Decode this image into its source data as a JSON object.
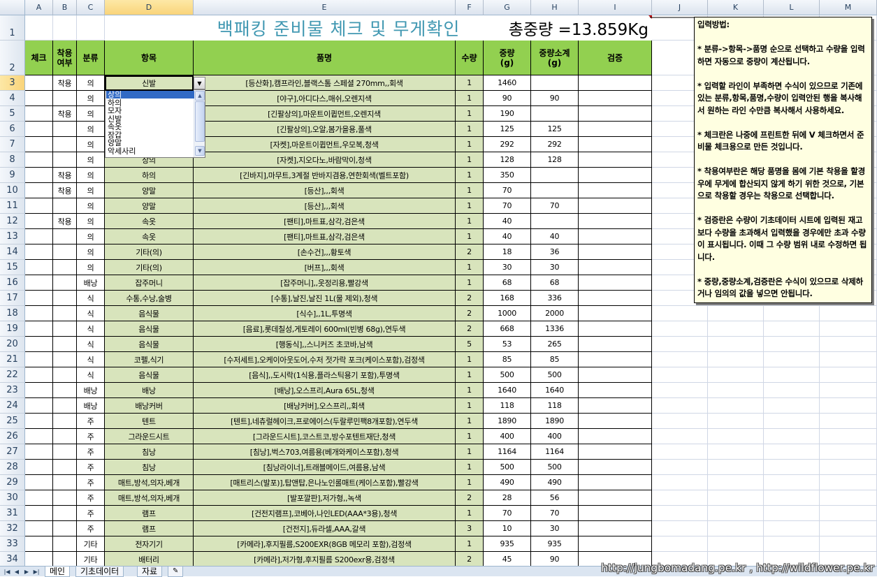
{
  "columns": [
    "A",
    "B",
    "C",
    "D",
    "E",
    "F",
    "G",
    "H",
    "I",
    "J",
    "K",
    "L",
    "M"
  ],
  "selected_column": "D",
  "selected_row": "3",
  "sheet_title": "백패킹 준비물 체크 및 무게확인",
  "total_weight": "총중량 =13.859Kg",
  "headers": {
    "check": "체크",
    "worn": "착용\n여부",
    "category": "분류",
    "item": "항목",
    "product": "품명",
    "qty": "수량",
    "weight": "중량\n(g)",
    "subtotal": "중량소계\n(g)",
    "verify": "검증"
  },
  "rows": [
    {
      "n": "3",
      "worn": "착용",
      "cat": "의",
      "item": "신발",
      "product": "[등산화],캠프라인,블랙스톰 스페셜 270mm,,회색",
      "qty": "1",
      "w": "1460",
      "sub": ""
    },
    {
      "n": "4",
      "worn": "",
      "cat": "의",
      "item": "",
      "product": "[야구],아디다스,매쉬,오렌지색",
      "qty": "1",
      "w": "90",
      "sub": "90"
    },
    {
      "n": "5",
      "worn": "착용",
      "cat": "의",
      "item": "",
      "product": "[긴팔상의],마운트이큅먼트,오렌지색",
      "qty": "1",
      "w": "190",
      "sub": ""
    },
    {
      "n": "6",
      "worn": "",
      "cat": "의",
      "item": "",
      "product": "[긴팔상의],오알,봄가을용,풀색",
      "qty": "1",
      "w": "125",
      "sub": "125"
    },
    {
      "n": "7",
      "worn": "",
      "cat": "의",
      "item": "",
      "product": "[자켓],마운트이큅먼트,우모복,청색",
      "qty": "1",
      "w": "292",
      "sub": "292"
    },
    {
      "n": "8",
      "worn": "",
      "cat": "의",
      "item": "상의",
      "product": "[자켓],지오다노,바람막이,청색",
      "qty": "1",
      "w": "128",
      "sub": "128"
    },
    {
      "n": "9",
      "worn": "착용",
      "cat": "의",
      "item": "하의",
      "product": "[긴바지],마무트,3계절 반바지겸용,연한회색(벨트포함)",
      "qty": "1",
      "w": "350",
      "sub": ""
    },
    {
      "n": "10",
      "worn": "착용",
      "cat": "의",
      "item": "양말",
      "product": "[등산],,,회색",
      "qty": "1",
      "w": "70",
      "sub": ""
    },
    {
      "n": "11",
      "worn": "",
      "cat": "의",
      "item": "양말",
      "product": "[등산],,,회색",
      "qty": "1",
      "w": "70",
      "sub": "70"
    },
    {
      "n": "12",
      "worn": "착용",
      "cat": "의",
      "item": "속옷",
      "product": "[팬티],마트표,삼각,검은색",
      "qty": "1",
      "w": "40",
      "sub": ""
    },
    {
      "n": "13",
      "worn": "",
      "cat": "의",
      "item": "속옷",
      "product": "[팬티],마트표,삼각,검은색",
      "qty": "1",
      "w": "40",
      "sub": "40"
    },
    {
      "n": "14",
      "worn": "",
      "cat": "의",
      "item": "기타(의)",
      "product": "[손수건],,,황토색",
      "qty": "2",
      "w": "18",
      "sub": "36"
    },
    {
      "n": "15",
      "worn": "",
      "cat": "의",
      "item": "기타(의)",
      "product": "[버프],,,회색",
      "qty": "1",
      "w": "30",
      "sub": "30"
    },
    {
      "n": "16",
      "worn": "",
      "cat": "배낭",
      "item": "잡주머니",
      "product": "[잡주머니],,옷정리용,빨강색",
      "qty": "1",
      "w": "68",
      "sub": "68"
    },
    {
      "n": "17",
      "worn": "",
      "cat": "식",
      "item": "수통,수낭,술병",
      "product": "[수통],날진,날진 1L(물 제외),청색",
      "qty": "2",
      "w": "168",
      "sub": "336"
    },
    {
      "n": "18",
      "worn": "",
      "cat": "식",
      "item": "음식물",
      "product": "[식수],,1L,투명색",
      "qty": "2",
      "w": "1000",
      "sub": "2000"
    },
    {
      "n": "19",
      "worn": "",
      "cat": "식",
      "item": "음식물",
      "product": "[음료],롯데칠성,게토레이 600ml(빈병 68g),연두색",
      "qty": "2",
      "w": "668",
      "sub": "1336"
    },
    {
      "n": "20",
      "worn": "",
      "cat": "식",
      "item": "음식물",
      "product": "[행동식],,스니커즈 초코바,남색",
      "qty": "5",
      "w": "53",
      "sub": "265"
    },
    {
      "n": "21",
      "worn": "",
      "cat": "식",
      "item": "코펠,식기",
      "product": "[수저세트],오케이아웃도어,수저 젓가락 포크(케이스포함),검정색",
      "qty": "1",
      "w": "85",
      "sub": "85"
    },
    {
      "n": "22",
      "worn": "",
      "cat": "식",
      "item": "음식물",
      "product": "[음식],,도시락(1식용,플라스틱용기 포함),투명색",
      "qty": "1",
      "w": "500",
      "sub": "500"
    },
    {
      "n": "23",
      "worn": "",
      "cat": "배낭",
      "item": "배낭",
      "product": "[배낭],오스프리,Aura 65L,청색",
      "qty": "1",
      "w": "1640",
      "sub": "1640"
    },
    {
      "n": "24",
      "worn": "",
      "cat": "배낭",
      "item": "배낭커버",
      "product": "[배낭커버],오스프리,,회색",
      "qty": "1",
      "w": "118",
      "sub": "118"
    },
    {
      "n": "25",
      "worn": "",
      "cat": "주",
      "item": "텐트",
      "product": "[텐트],네츄럴헤이크,프로에이스(두랄루민팩8개포함),연두색",
      "qty": "1",
      "w": "1890",
      "sub": "1890"
    },
    {
      "n": "26",
      "worn": "",
      "cat": "주",
      "item": "그라운드시트",
      "product": "[그라운드시트],코스트코,방수포텐트재단,청색",
      "qty": "1",
      "w": "400",
      "sub": "400"
    },
    {
      "n": "27",
      "worn": "",
      "cat": "주",
      "item": "침낭",
      "product": "[침낭],벅스703,여름용(베개와케이스포함),청색",
      "qty": "1",
      "w": "1164",
      "sub": "1164"
    },
    {
      "n": "28",
      "worn": "",
      "cat": "주",
      "item": "침낭",
      "product": "[침낭라이너],트래블메이드,여름용,남색",
      "qty": "1",
      "w": "500",
      "sub": "500"
    },
    {
      "n": "29",
      "worn": "",
      "cat": "주",
      "item": "매트,방석,의자,베개",
      "product": "[매트리스(발포)],탑앤탑,은나노인롤매트(케이스포함),빨강색",
      "qty": "1",
      "w": "490",
      "sub": "490"
    },
    {
      "n": "30",
      "worn": "",
      "cat": "주",
      "item": "매트,방석,의자,베개",
      "product": "[발포깔판],저가형,,녹색",
      "qty": "2",
      "w": "28",
      "sub": "56"
    },
    {
      "n": "31",
      "worn": "",
      "cat": "주",
      "item": "램프",
      "product": "[건전지램프],코베아,나인LED(AAA*3용),청색",
      "qty": "1",
      "w": "70",
      "sub": "70"
    },
    {
      "n": "32",
      "worn": "",
      "cat": "주",
      "item": "램프",
      "product": "[건전지],듀라셀,AAA,갈색",
      "qty": "3",
      "w": "10",
      "sub": "30"
    },
    {
      "n": "33",
      "worn": "",
      "cat": "기타",
      "item": "전자기기",
      "product": "[카메라],후지필름,S200EXR(8GB 메모리 포함),검정색",
      "qty": "1",
      "w": "935",
      "sub": "935"
    },
    {
      "n": "34",
      "worn": "",
      "cat": "기타",
      "item": "배터리",
      "product": "[카메라],저가형,후지필름 S200exr용,검정색",
      "qty": "2",
      "w": "45",
      "sub": "90"
    }
  ],
  "dropdown": {
    "options": [
      "상의",
      "하의",
      "모자",
      "신발",
      "속옷",
      "장갑",
      "양말",
      "악세사리"
    ],
    "selected": "상의"
  },
  "comment": "입력방법:\n\n* 분류->항목->품명 순으로 선택하고 수량을 입력하면 자동으로 중량이 계산됩니다.\n\n* 입력할 라인이 부족하면 수식이 있으므로 기존에 있는 분류,항목,품명,수량이 입력안된 행을 복사해서 원하는 라인 수만큼 복사해서 사용하세요.\n\n* 체크란은 나중에 프린트한 뒤에 V 체크하면서 준비물 체크용으로 만든 것입니다.\n\n* 착용여부란은 해당 품명을 몸에 기본 착용을 할경우에 무게에 합산되지 않게 하기 위한 것으로, 기본으로 착용할 경우는 착용으로 선택합니다.\n\n* 검증란은 수량이 기초데이터 시트에 입력된 재고보다 수량을 초과해서 입력했을 경우에만 초과 수량이 표시됩니다. 이때 그 수량 범위 내로 수정하면 됩니다.\n\n* 중량,중량소계,검증란은 수식이 있으므로 삭제하거나 임의의 값을 넣으면 안됩니다.",
  "tabs": [
    "메인",
    "기초데이터",
    "자료"
  ],
  "active_tab": "메인",
  "watermark": "http://jungbomadang.pe.kr , http://wildflower.pe.kr",
  "colors": {
    "header_green": "#92d050",
    "cell_green": "#d8e4bc",
    "title_blue": "#4198b2",
    "comment_bg": "#ffffe1"
  }
}
